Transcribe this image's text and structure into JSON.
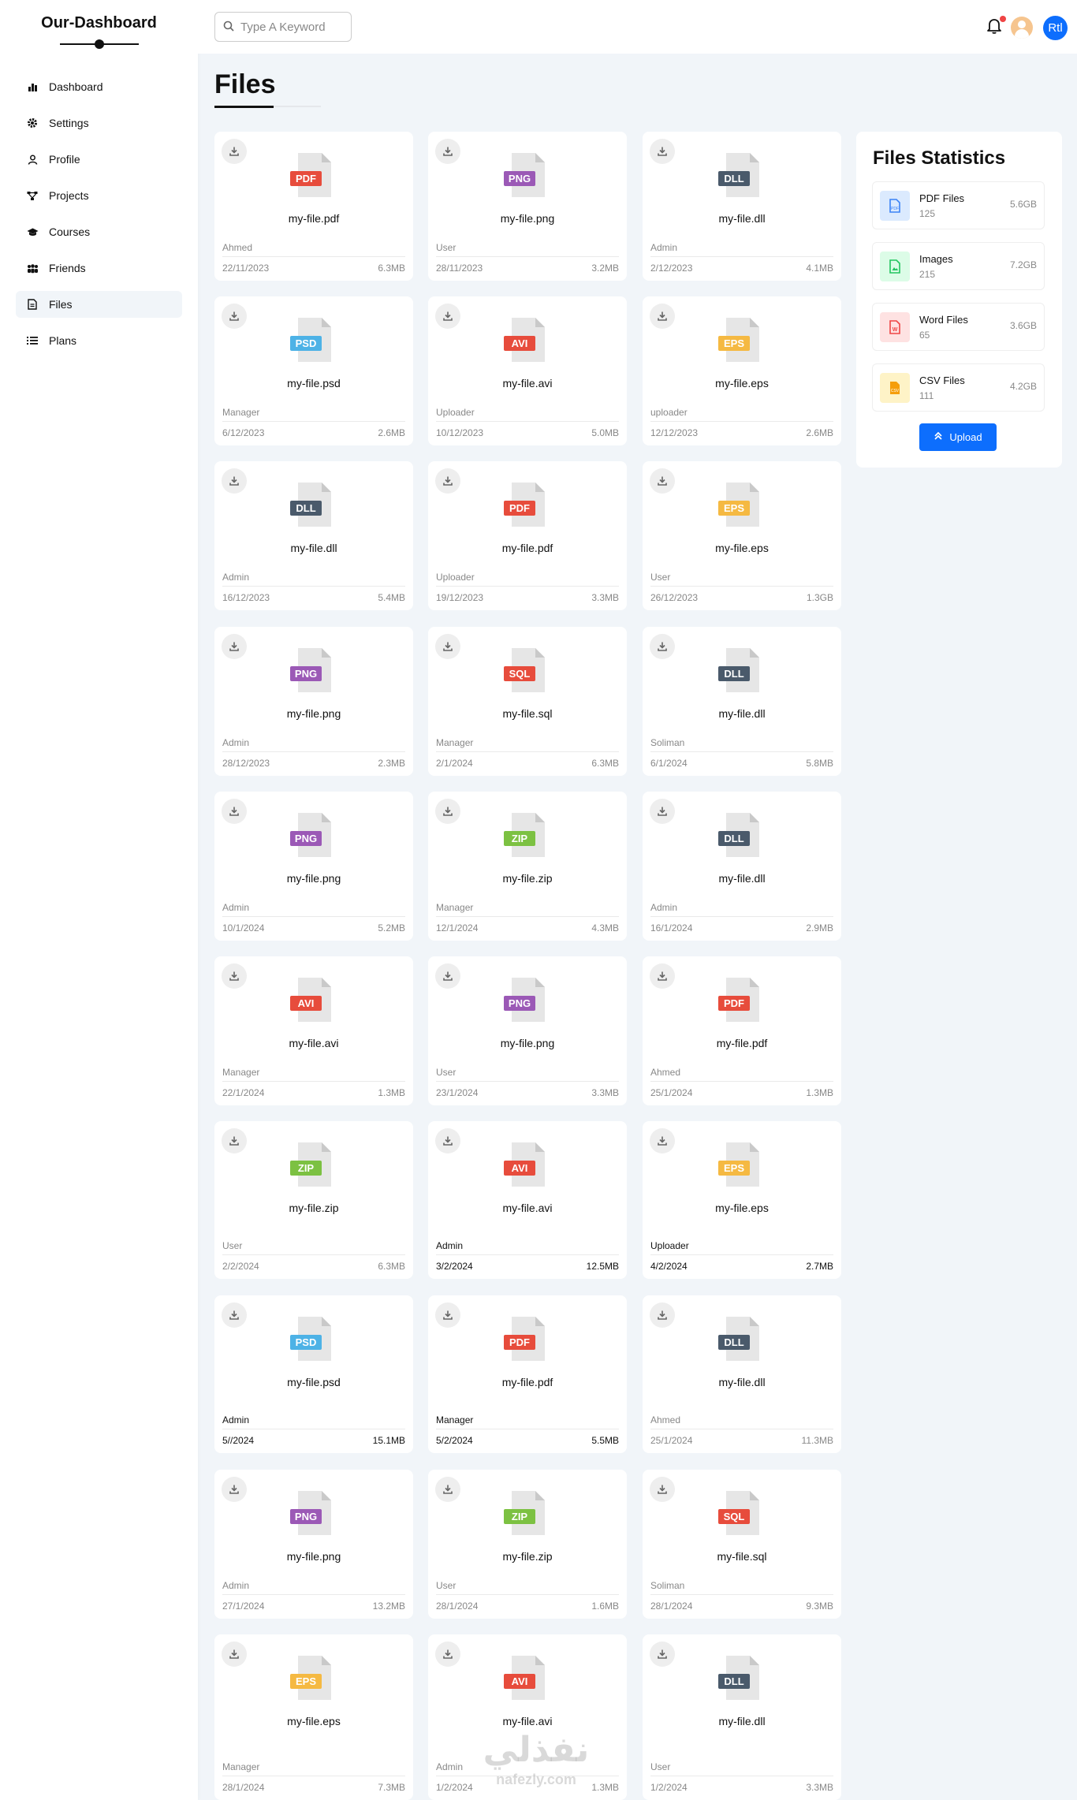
{
  "brand": "Our-Dashboard",
  "nav": [
    {
      "label": "Dashboard",
      "icon": "chart-bar-icon"
    },
    {
      "label": "Settings",
      "icon": "gear-icon"
    },
    {
      "label": "Profile",
      "icon": "user-icon"
    },
    {
      "label": "Projects",
      "icon": "diagram-icon"
    },
    {
      "label": "Courses",
      "icon": "graduation-cap-icon"
    },
    {
      "label": "Friends",
      "icon": "users-icon"
    },
    {
      "label": "Files",
      "icon": "file-icon",
      "active": true
    },
    {
      "label": "Plans",
      "icon": "list-icon"
    }
  ],
  "topbar": {
    "search_placeholder": "Type A Keyword",
    "rtl_label": "Rtl"
  },
  "page_title": "Files",
  "colors": {
    "PDF": "#e74c3c",
    "PNG": "#9b59b6",
    "DLL": "#4a5a6b",
    "PSD": "#4db2e6",
    "AVI": "#e74c3c",
    "EPS": "#f5b942",
    "SQL": "#e74c3c",
    "ZIP": "#7cc142",
    "accent": "#0d6efd"
  },
  "files": [
    {
      "type": "PDF",
      "name": "my-file.pdf",
      "user": "Ahmed",
      "date": "22/11/2023",
      "size": "6.3MB"
    },
    {
      "type": "PNG",
      "name": "my-file.png",
      "user": "User",
      "date": "28/11/2023",
      "size": "3.2MB"
    },
    {
      "type": "DLL",
      "name": "my-file.dll",
      "user": "Admin",
      "date": "2/12/2023",
      "size": "4.1MB"
    },
    {
      "type": "PSD",
      "name": "my-file.psd",
      "user": "Manager",
      "date": "6/12/2023",
      "size": "2.6MB"
    },
    {
      "type": "AVI",
      "name": "my-file.avi",
      "user": "Uploader",
      "date": "10/12/2023",
      "size": "5.0MB"
    },
    {
      "type": "EPS",
      "name": "my-file.eps",
      "user": "uploader",
      "date": "12/12/2023",
      "size": "2.6MB"
    },
    {
      "type": "DLL",
      "name": "my-file.dll",
      "user": "Admin",
      "date": "16/12/2023",
      "size": "5.4MB"
    },
    {
      "type": "PDF",
      "name": "my-file.pdf",
      "user": "Uploader",
      "date": "19/12/2023",
      "size": "3.3MB"
    },
    {
      "type": "EPS",
      "name": "my-file.eps",
      "user": "User",
      "date": "26/12/2023",
      "size": "1.3GB"
    },
    {
      "type": "PNG",
      "name": "my-file.png",
      "user": "Admin",
      "date": "28/12/2023",
      "size": "2.3MB"
    },
    {
      "type": "SQL",
      "name": "my-file.sql",
      "user": "Manager",
      "date": "2/1/2024",
      "size": "6.3MB"
    },
    {
      "type": "DLL",
      "name": "my-file.dll",
      "user": "Soliman",
      "date": "6/1/2024",
      "size": "5.8MB"
    },
    {
      "type": "PNG",
      "name": "my-file.png",
      "user": "Admin",
      "date": "10/1/2024",
      "size": "5.2MB"
    },
    {
      "type": "ZIP",
      "name": "my-file.zip",
      "user": "Manager",
      "date": "12/1/2024",
      "size": "4.3MB"
    },
    {
      "type": "DLL",
      "name": "my-file.dll",
      "user": "Admin",
      "date": "16/1/2024",
      "size": "2.9MB"
    },
    {
      "type": "AVI",
      "name": "my-file.avi",
      "user": "Manager",
      "date": "22/1/2024",
      "size": "1.3MB"
    },
    {
      "type": "PNG",
      "name": "my-file.png",
      "user": "User",
      "date": "23/1/2024",
      "size": "3.3MB"
    },
    {
      "type": "PDF",
      "name": "my-file.pdf",
      "user": "Ahmed",
      "date": "25/1/2024",
      "size": "1.3MB"
    },
    {
      "type": "ZIP",
      "name": "my-file.zip",
      "user": "User",
      "date": "2/2/2024",
      "size": "6.3MB"
    },
    {
      "type": "AVI",
      "name": "my-file.avi",
      "user": "Admin",
      "date": "3/2/2024",
      "size": "12.5MB",
      "emph": true
    },
    {
      "type": "EPS",
      "name": "my-file.eps",
      "user": "Uploader",
      "date": "4/2/2024",
      "size": "2.7MB",
      "emph": true
    },
    {
      "type": "PSD",
      "name": "my-file.psd",
      "user": "Admin",
      "date": "5//2024",
      "size": "15.1MB",
      "emph": true
    },
    {
      "type": "PDF",
      "name": "my-file.pdf",
      "user": "Manager",
      "date": "5/2/2024",
      "size": "5.5MB",
      "emph": true
    },
    {
      "type": "DLL",
      "name": "my-file.dll",
      "user": "Ahmed",
      "date": "25/1/2024",
      "size": "11.3MB"
    },
    {
      "type": "PNG",
      "name": "my-file.png",
      "user": "Admin",
      "date": "27/1/2024",
      "size": "13.2MB"
    },
    {
      "type": "ZIP",
      "name": "my-file.zip",
      "user": "User",
      "date": "28/1/2024",
      "size": "1.6MB"
    },
    {
      "type": "SQL",
      "name": "my-file.sql",
      "user": "Soliman",
      "date": "28/1/2024",
      "size": "9.3MB"
    },
    {
      "type": "EPS",
      "name": "my-file.eps",
      "user": "Manager",
      "date": "28/1/2024",
      "size": "7.3MB"
    },
    {
      "type": "AVI",
      "name": "my-file.avi",
      "user": "Admin",
      "date": "1/2/2024",
      "size": "1.3MB"
    },
    {
      "type": "DLL",
      "name": "my-file.dll",
      "user": "User",
      "date": "1/2/2024",
      "size": "3.3MB"
    }
  ],
  "stats": {
    "title": "Files Statistics",
    "items": [
      {
        "name": "PDF Files",
        "count": "125",
        "size": "5.6GB",
        "icon": "pdf-file-icon",
        "bg": "#dbeafe",
        "fg": "#3b82f6"
      },
      {
        "name": "Images",
        "count": "215",
        "size": "7.2GB",
        "icon": "image-file-icon",
        "bg": "#dcfce7",
        "fg": "#22c55e"
      },
      {
        "name": "Word Files",
        "count": "65",
        "size": "3.6GB",
        "icon": "word-file-icon",
        "bg": "#fee2e2",
        "fg": "#ef4444"
      },
      {
        "name": "CSV Files",
        "count": "111",
        "size": "4.2GB",
        "icon": "csv-file-icon",
        "bg": "#fef3c7",
        "fg": "#f59e0b"
      }
    ],
    "upload_label": "Upload"
  },
  "watermark": {
    "arabic": "نفذلي",
    "latin": "nafezly.com"
  }
}
